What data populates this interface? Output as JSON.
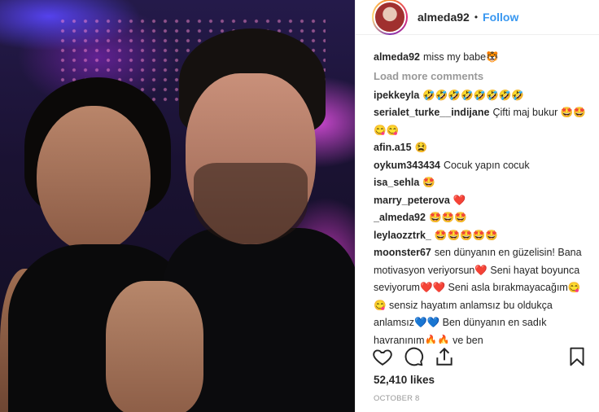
{
  "post": {
    "username": "almeda92",
    "follow_label": "Follow",
    "separator": "•",
    "likes": "52,410 likes",
    "date": "OCTOBER 8"
  },
  "comments": {
    "load_more": "Load more comments",
    "caption": {
      "user": "almeda92",
      "text": "miss my babe🐯"
    },
    "items": [
      {
        "user": "ipekkeyla",
        "text": "🤣🤣🤣🤣🤣🤣🤣🤣"
      },
      {
        "user": "serialet_turke__indijane",
        "text": "Çifti maj bukur 🤩🤩😋😋"
      },
      {
        "user": "afin.a15",
        "text": "😫"
      },
      {
        "user": "oykum343434",
        "text": "Cocuk yapın cocuk"
      },
      {
        "user": "isa_sehla",
        "text": "🤩"
      },
      {
        "user": "marry_peterova",
        "text": "❤️"
      },
      {
        "user": "_almeda92",
        "text": "🤩🤩🤩"
      },
      {
        "user": "leylaozztrk_",
        "text": "🤩🤩🤩🤩🤩"
      },
      {
        "user": "moonster67",
        "text": "sen dünyanın en güzelisin! Bana motivasyon veriyorsun❤️ Seni hayat boyunca seviyorum❤️❤️ Seni asla bırakmayacağım😋😋 sensiz hayatım anlamsız bu oldukça anlamsız💙💙 Ben dünyanın en sadık hayranınım🔥🔥 ve ben"
      }
    ]
  },
  "icons": {
    "like": "heart-icon",
    "comment": "comment-icon",
    "share": "share-icon",
    "save": "bookmark-icon"
  }
}
